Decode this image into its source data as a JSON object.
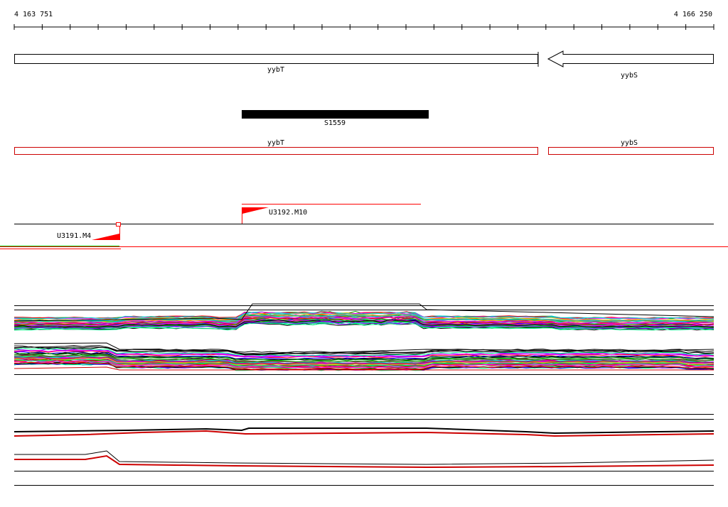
{
  "coordinates": {
    "start": "4 163 751",
    "end": "4 166 250"
  },
  "genes": [
    {
      "name": "yybT",
      "strand": "+"
    },
    {
      "name": "yybS",
      "strand": "-"
    }
  ],
  "feature": {
    "name": "S1559"
  },
  "annotation_track": [
    {
      "name": "yybT"
    },
    {
      "name": "yybS"
    }
  ],
  "promoters": [
    {
      "name": "U3192.M10"
    },
    {
      "name": "U3191.M4"
    }
  ],
  "colors": {
    "axis": "#000000",
    "annotation_outline": "#cc0000",
    "promoter": "#ff0000",
    "feature_fill": "#000000",
    "profile_palette": [
      "#ff0000",
      "#00aa00",
      "#0000ff",
      "#ff00ff",
      "#00cccc",
      "#cccc00",
      "#ff8800",
      "#8800ff",
      "#888888",
      "#aa0044",
      "#00ff88",
      "#000000"
    ]
  },
  "profiles": {
    "multi_condition_panel": "colored expression profiles",
    "summary_panel": "black and red summary profiles"
  }
}
